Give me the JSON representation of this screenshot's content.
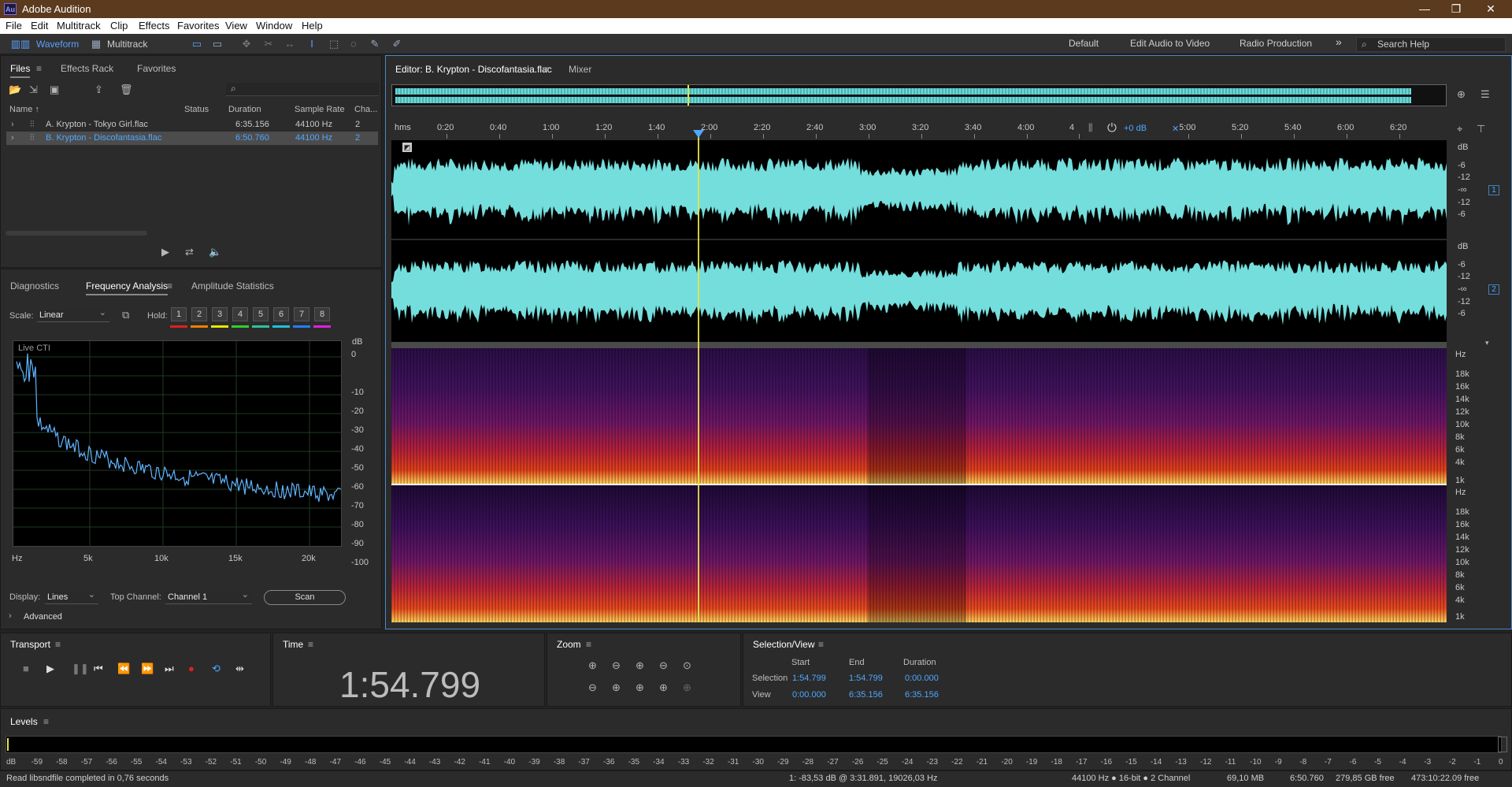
{
  "app": {
    "title": "Adobe Audition",
    "logo": "Au"
  },
  "window_controls": {
    "minimize": "—",
    "maximize": "❐",
    "close": "✕"
  },
  "menu": [
    "File",
    "Edit",
    "Multitrack",
    "Clip",
    "Effects",
    "Favorites",
    "View",
    "Window",
    "Help"
  ],
  "toolbar": {
    "waveform": "Waveform",
    "multitrack": "Multitrack"
  },
  "workspaces": [
    "Default",
    "Edit Audio to Video",
    "Radio Production"
  ],
  "workspace_more": "»",
  "search_help": "Search Help",
  "files_panel": {
    "tabs": [
      "Files",
      "Effects Rack",
      "Favorites"
    ],
    "columns": [
      "Name ↑",
      "Status",
      "Duration",
      "Sample Rate",
      "Cha..."
    ],
    "rows": [
      {
        "name": "A. Krypton - Tokyo Girl.flac",
        "status": "",
        "duration": "6:35.156",
        "rate": "44100 Hz",
        "ch": "2",
        "selected": false
      },
      {
        "name": "B. Krypton - Discofantasia.flac",
        "status": "",
        "duration": "6:50.760",
        "rate": "44100 Hz",
        "ch": "2",
        "selected": true
      }
    ]
  },
  "analysis_panel": {
    "tabs": [
      "Diagnostics",
      "Frequency Analysis",
      "Amplitude Statistics"
    ],
    "scale_label": "Scale:",
    "scale_value": "Linear",
    "hold_label": "Hold:",
    "hold": [
      "1",
      "2",
      "3",
      "4",
      "5",
      "6",
      "7",
      "8"
    ],
    "hold_colors": [
      "#e02020",
      "#f08000",
      "#e8e800",
      "#30d030",
      "#30c0a0",
      "#20c0e0",
      "#2080ff",
      "#e020e0"
    ],
    "graph_label": "Live CTI",
    "db_title": "dB",
    "db_ticks": [
      "0",
      "-10",
      "-20",
      "-30",
      "-40",
      "-50",
      "-60",
      "-70",
      "-80",
      "-90",
      "-100"
    ],
    "hz_ticks": [
      "Hz",
      "5k",
      "10k",
      "15k",
      "20k"
    ],
    "display_label": "Display:",
    "display_value": "Lines",
    "top_channel_label": "Top Channel:",
    "top_channel_value": "Channel 1",
    "scan_label": "Scan",
    "advanced_label": "Advanced"
  },
  "editor": {
    "tab": "Editor: B. Krypton - Discofantasia.flac",
    "mixer_tab": "Mixer",
    "timeline_unit": "hms",
    "timeline": [
      "0:20",
      "0:40",
      "1:00",
      "1:20",
      "1:40",
      "2:00",
      "2:20",
      "2:40",
      "3:00",
      "3:20",
      "3:40",
      "4:00",
      "4",
      "5:00",
      "5:20",
      "5:40",
      "6:00",
      "6:20"
    ],
    "volume": "+0 dB",
    "db_label": "dB",
    "channel_db_ticks": [
      "-6",
      "-12",
      "-∞",
      "-12",
      "-6"
    ],
    "channels": [
      "1",
      "2"
    ],
    "hz_label": "Hz",
    "hz_ticks": [
      "18k",
      "16k",
      "14k",
      "12k",
      "10k",
      "8k",
      "6k",
      "4k",
      "1k"
    ]
  },
  "transport": {
    "title": "Transport"
  },
  "time": {
    "title": "Time",
    "value": "1:54.799"
  },
  "zoom": {
    "title": "Zoom"
  },
  "selection_view": {
    "title": "Selection/View",
    "headers": [
      "Start",
      "End",
      "Duration"
    ],
    "selection": {
      "label": "Selection",
      "start": "1:54.799",
      "end": "1:54.799",
      "duration": "0:00.000"
    },
    "view": {
      "label": "View",
      "start": "0:00.000",
      "end": "6:35.156",
      "duration": "6:35.156"
    }
  },
  "levels": {
    "title": "Levels",
    "ticks": [
      "dB",
      "-59",
      "-58",
      "-57",
      "-56",
      "-55",
      "-54",
      "-53",
      "-52",
      "-51",
      "-50",
      "-49",
      "-48",
      "-47",
      "-46",
      "-45",
      "-44",
      "-43",
      "-42",
      "-41",
      "-40",
      "-39",
      "-38",
      "-37",
      "-36",
      "-35",
      "-34",
      "-33",
      "-32",
      "-31",
      "-30",
      "-29",
      "-28",
      "-27",
      "-26",
      "-25",
      "-24",
      "-23",
      "-22",
      "-21",
      "-20",
      "-19",
      "-18",
      "-17",
      "-16",
      "-15",
      "-14",
      "-13",
      "-12",
      "-11",
      "-10",
      "-9",
      "-8",
      "-7",
      "-6",
      "-5",
      "-4",
      "-3",
      "-2",
      "-1",
      "0"
    ]
  },
  "status": {
    "message": "Read libsndfile completed in 0,76 seconds",
    "cursor": "1: -83,53 dB @ 3:31.891, 19026,03 Hz",
    "format": "44100 Hz ● 16-bit ● 2 Channel",
    "size": "69,10 MB",
    "duration": "6:50.760",
    "free": "279,85 GB free",
    "free_time": "473:10:22.09 free"
  }
}
